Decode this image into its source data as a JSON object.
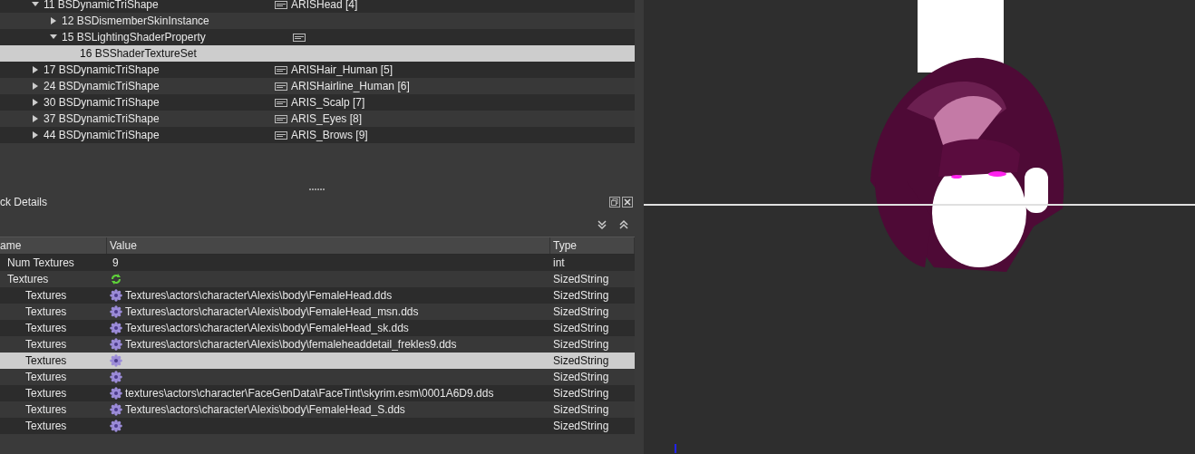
{
  "tree": [
    {
      "label": "11 BSDynamicTriShape",
      "expanded": true,
      "selected": false,
      "kind": "text",
      "name": "ARISHead [4]",
      "children": [
        {
          "label": "12 BSDismemberSkinInstance",
          "expanded": false,
          "selected": false,
          "kind": "plain"
        },
        {
          "label": "15 BSLightingShaderProperty",
          "expanded": true,
          "selected": false,
          "kind": "text",
          "children": [
            {
              "label": "16 BSShaderTextureSet",
              "selected": true
            }
          ]
        }
      ]
    },
    {
      "label": "17 BSDynamicTriShape",
      "expanded": false,
      "selected": false,
      "kind": "text",
      "name": "ARISHair_Human [5]"
    },
    {
      "label": "24 BSDynamicTriShape",
      "expanded": false,
      "selected": false,
      "kind": "text",
      "name": "ARISHairline_Human [6]"
    },
    {
      "label": "30 BSDynamicTriShape",
      "expanded": false,
      "selected": false,
      "kind": "text",
      "name": "ARIS_Scalp [7]"
    },
    {
      "label": "37 BSDynamicTriShape",
      "expanded": false,
      "selected": false,
      "kind": "text",
      "name": "ARIS_Eyes [8]"
    },
    {
      "label": "44 BSDynamicTriShape",
      "expanded": false,
      "selected": false,
      "kind": "text",
      "name": "ARIS_Brows [9]"
    }
  ],
  "details": {
    "title": "ck Details",
    "columns": [
      "ame",
      "Value",
      "Type"
    ],
    "rows": [
      {
        "name": "Num Textures",
        "value": "9",
        "type": "int",
        "kind": "number",
        "selected": false
      },
      {
        "name": "Textures",
        "kind": "array",
        "type": "SizedString",
        "selected": false,
        "children": [
          {
            "name": "Textures",
            "kind": "string",
            "value": "Textures\\actors\\character\\Alexis\\body\\FemaleHead.dds",
            "type": "SizedString",
            "selected": false
          },
          {
            "name": "Textures",
            "kind": "string",
            "value": "Textures\\actors\\character\\Alexis\\body\\FemaleHead_msn.dds",
            "type": "SizedString",
            "selected": false
          },
          {
            "name": "Textures",
            "kind": "string",
            "value": "Textures\\actors\\character\\Alexis\\body\\FemaleHead_sk.dds",
            "type": "SizedString",
            "selected": false
          },
          {
            "name": "Textures",
            "kind": "string",
            "value": "Textures\\actors\\character\\Alexis\\body\\femaleheaddetail_frekles9.dds",
            "type": "SizedString",
            "selected": false
          },
          {
            "name": "Textures",
            "kind": "string",
            "type": "SizedString",
            "selected": true
          },
          {
            "name": "Textures",
            "kind": "string",
            "type": "SizedString",
            "selected": false
          },
          {
            "name": "Textures",
            "kind": "string",
            "value": "textures\\actors\\character\\FaceGenData\\FaceTint\\skyrim.esm\\0001A6D9.dds",
            "type": "SizedString",
            "selected": false
          },
          {
            "name": "Textures",
            "kind": "string",
            "value": "Textures\\actors\\character\\Alexis\\body\\FemaleHead_S.dds",
            "type": "SizedString",
            "selected": false
          },
          {
            "name": "Textures",
            "kind": "string",
            "type": "SizedString",
            "selected": false
          }
        ]
      }
    ]
  }
}
